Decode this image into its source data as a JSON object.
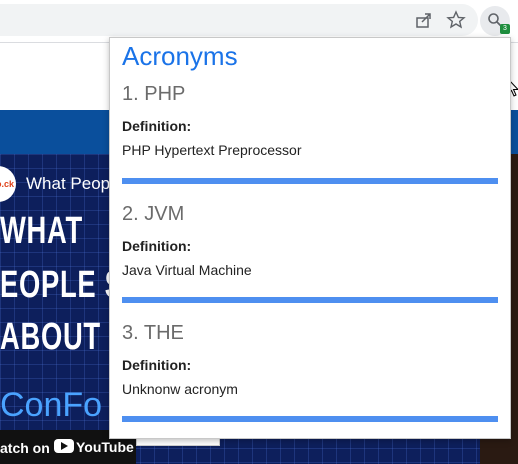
{
  "popup": {
    "title": "Acronyms",
    "accent_color": "#1a73e8",
    "divider_color": "#4e8ff0",
    "definition_label": "Definition:",
    "entries": [
      {
        "heading": "1. PHP",
        "definition": "PHP Hypertext Preprocessor"
      },
      {
        "heading": "2. JVM",
        "definition": "Java Virtual Machine"
      },
      {
        "heading": "3. THE",
        "definition": "Unknonw acronym"
      }
    ]
  },
  "toolbar": {
    "icons": [
      "share-icon",
      "star-icon",
      "extension-search-icon"
    ],
    "extension_badge": "3"
  },
  "background_page": {
    "video_title": "What Peop",
    "thumbnail_lines": [
      "WHAT",
      "EOPLE SA",
      "ABOUT"
    ],
    "brand_text": "ConFo",
    "watch_text": "atch on",
    "youtube_text": "YouTube"
  }
}
